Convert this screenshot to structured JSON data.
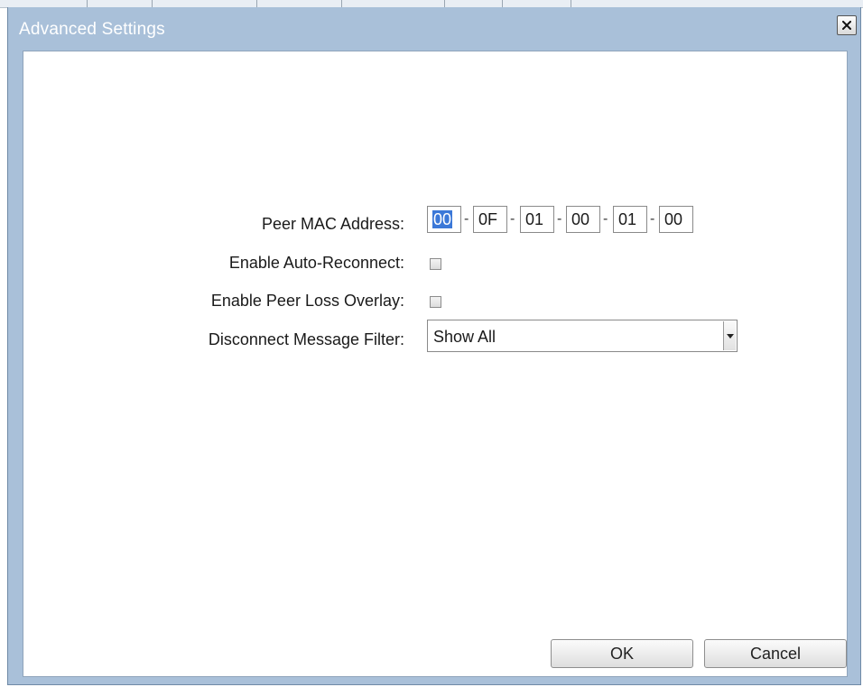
{
  "dialog": {
    "title": "Advanced Settings",
    "close_icon": "close-icon"
  },
  "form": {
    "peer_mac_label": "Peer MAC Address:",
    "mac_octets": [
      "00",
      "0F",
      "01",
      "00",
      "01",
      "00"
    ],
    "mac_separator": "-",
    "auto_reconnect_label": "Enable Auto-Reconnect:",
    "auto_reconnect_checked": false,
    "peer_loss_overlay_label": "Enable Peer Loss Overlay:",
    "peer_loss_overlay_checked": false,
    "disconnect_filter_label": "Disconnect Message Filter:",
    "disconnect_filter_value": "Show All"
  },
  "buttons": {
    "ok": "OK",
    "cancel": "Cancel"
  },
  "colors": {
    "title_bar": "#a9c0d9",
    "selection": "#3b78d8"
  }
}
